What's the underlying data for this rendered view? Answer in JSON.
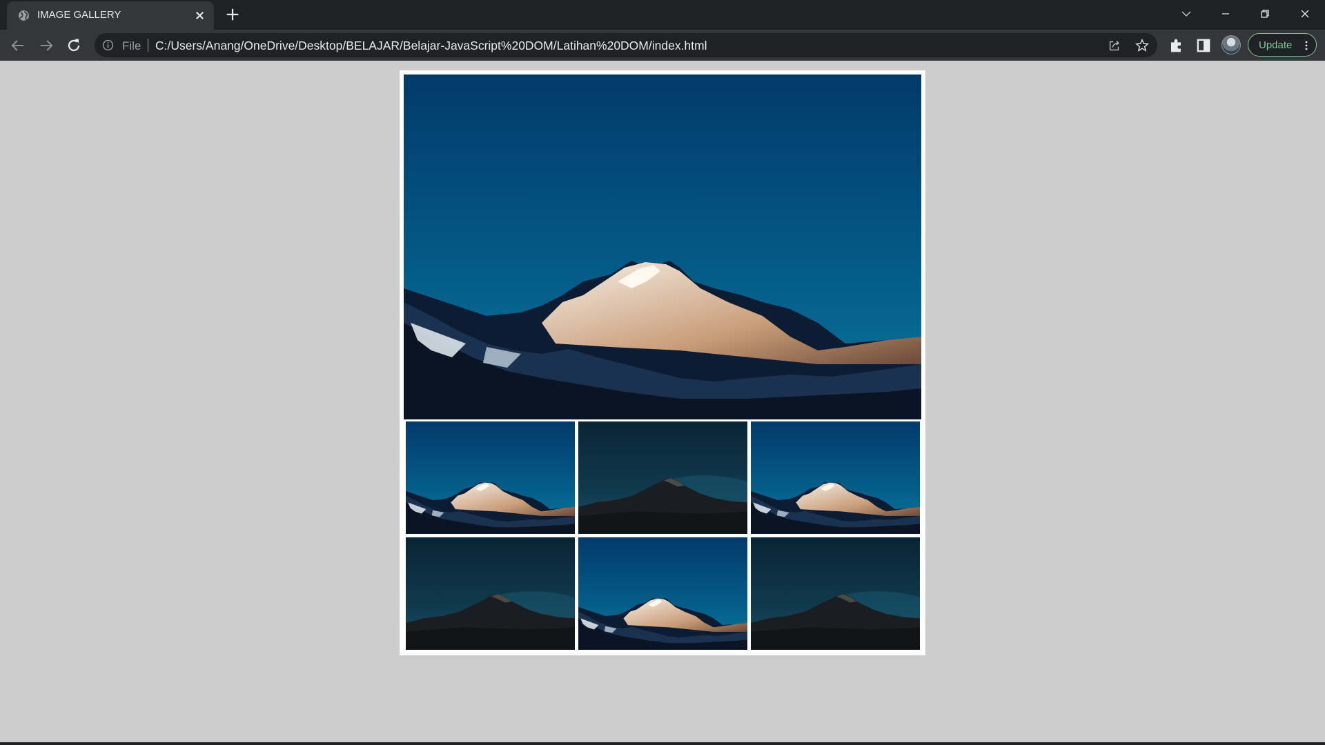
{
  "browser": {
    "tab": {
      "title": "IMAGE GALLERY",
      "favicon": "globe-icon"
    },
    "address_bar": {
      "scheme_label": "File",
      "url": "C:/Users/Anang/OneDrive/Desktop/BELAJAR/Belajar-JavaScript%20DOM/Latihan%20DOM/index.html"
    },
    "update_button": {
      "label": "Update",
      "accent": "#81c995"
    },
    "colors": {
      "titlebar": "#202124",
      "toolbar": "#35363a",
      "text": "#e8eaed"
    }
  },
  "page": {
    "background": "#cccccc",
    "gallery": {
      "main_image": {
        "scene": "sunset-mountain"
      },
      "thumbnails": [
        {
          "scene": "sunset-mountain"
        },
        {
          "scene": "night-mountain"
        },
        {
          "scene": "sunset-mountain"
        },
        {
          "scene": "night-mountain"
        },
        {
          "scene": "sunset-mountain"
        },
        {
          "scene": "night-mountain"
        }
      ]
    }
  }
}
